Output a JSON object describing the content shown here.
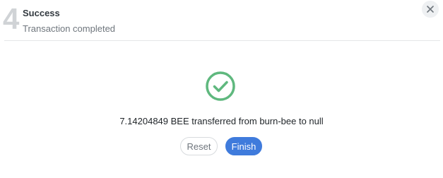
{
  "step": {
    "number": "4",
    "title": "Success",
    "subtitle": "Transaction completed"
  },
  "icons": {
    "close": "close-icon",
    "success": "check-circle-icon"
  },
  "result": {
    "message": "7.14204849 BEE transferred from burn-bee to null"
  },
  "actions": {
    "reset_label": "Reset",
    "finish_label": "Finish"
  },
  "colors": {
    "success_green": "#5fb87e",
    "primary_blue": "#3f7bdc",
    "step_number_gray": "#d0d3d6"
  }
}
